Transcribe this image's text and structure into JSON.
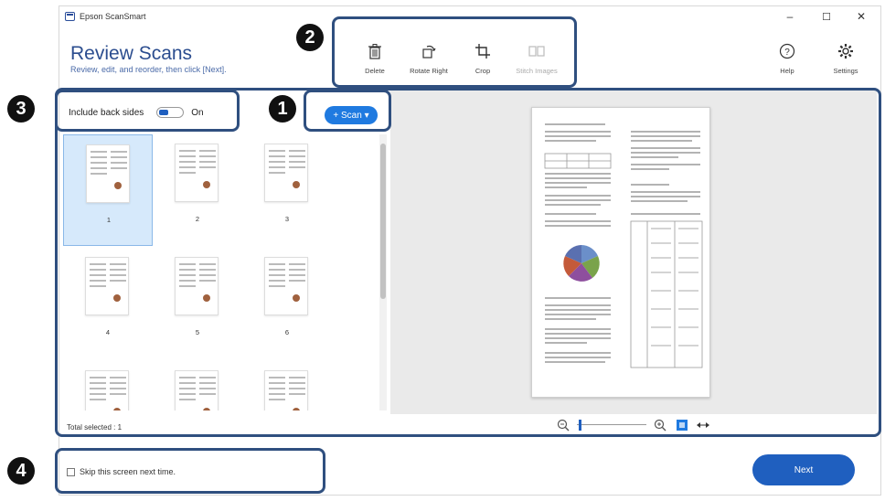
{
  "window": {
    "app_title": "Epson ScanSmart",
    "minimize": "–",
    "maximize": "☐",
    "close": "✕"
  },
  "header": {
    "title": "Review Scans",
    "subtitle": "Review, edit, and reorder, then click [Next]."
  },
  "toolbar": {
    "delete_label": "Delete",
    "rotate_label": "Rotate Right",
    "crop_label": "Crop",
    "stitch_label": "Stitch Images",
    "help_label": "Help",
    "settings_label": "Settings"
  },
  "left_panel": {
    "include_back_label": "Include back sides",
    "include_back_state": "On",
    "scan_button": "+ Scan ▾",
    "thumbnails": [
      "1",
      "2",
      "3",
      "4",
      "5",
      "6",
      "",
      "",
      ""
    ],
    "selected_index": 0,
    "total_selected": "Total selected : 1"
  },
  "footer": {
    "skip_label": "Skip this screen next time.",
    "next_label": "Next"
  },
  "callouts": {
    "one": "1",
    "two": "2",
    "three": "3",
    "four": "4"
  },
  "colors": {
    "accent": "#1f5fbf",
    "callout_border": "#2f4f7f",
    "title_blue": "#2b4d8f"
  },
  "icons": [
    "app-icon",
    "trash-icon",
    "rotate-right-icon",
    "crop-icon",
    "stitch-icon",
    "help-icon",
    "gear-icon",
    "zoom-out-icon",
    "zoom-in-icon",
    "fit-icon",
    "expand-icon"
  ]
}
